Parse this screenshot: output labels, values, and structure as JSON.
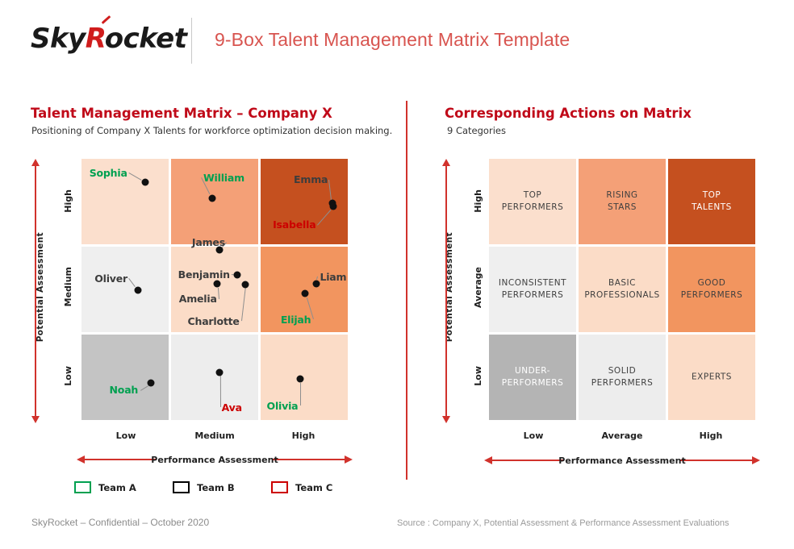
{
  "header": {
    "logo_part1": "Sky",
    "logo_part2": "R",
    "logo_part3": "ocket",
    "title": "9-Box Talent Management Matrix Template"
  },
  "left_panel": {
    "title": "Talent Management Matrix – Company X",
    "subtitle": "Positioning of Company X Talents for workforce optimization decision making.",
    "y_axis_title": "Potential Assessment",
    "y_ticks": [
      "High",
      "Medium",
      "Low"
    ],
    "x_axis_title": "Performance Assessment",
    "x_ticks": [
      "Low",
      "Medium",
      "High"
    ],
    "cell_colors": [
      [
        "#FBDFCD",
        "#F4A077",
        "#C5501F"
      ],
      [
        "#EFEFEF",
        "#FBDCC7",
        "#F2955F"
      ],
      [
        "#C4C4C4",
        "#EDEDED",
        "#FBDCC7"
      ]
    ],
    "people": [
      {
        "name": "Sophia",
        "team": "team-a",
        "cell": 0,
        "dot_x": 0.73,
        "dot_y": 0.27,
        "label_x": 0.09,
        "label_y": 0.09,
        "label_anchor": "left"
      },
      {
        "name": "William",
        "team": "team-a",
        "cell": 1,
        "dot_x": 0.47,
        "dot_y": 0.46,
        "label_x": 0.37,
        "label_y": 0.15,
        "label_anchor": "left"
      },
      {
        "name": "Emma",
        "team": "team-b",
        "cell": 2,
        "dot_x": 0.82,
        "dot_y": 0.52,
        "label_x": 0.38,
        "label_y": 0.17,
        "label_anchor": "left"
      },
      {
        "name": "Isabella",
        "team": "team-c",
        "cell": 2,
        "dot_x": 0.83,
        "dot_y": 0.56,
        "label_x": 0.14,
        "label_y": 0.7,
        "label_anchor": "left"
      },
      {
        "name": "Oliver",
        "team": "team-b",
        "cell": 3,
        "dot_x": 0.65,
        "dot_y": 0.51,
        "label_x": 0.15,
        "label_y": 0.3,
        "label_anchor": "left"
      },
      {
        "name": "James",
        "team": "team-b",
        "cell": 4,
        "dot_x": 0.56,
        "dot_y": 0.04,
        "label_x": 0.24,
        "label_y": -0.12,
        "label_anchor": "left"
      },
      {
        "name": "Benjamin",
        "team": "team-b",
        "cell": 4,
        "dot_x": 0.76,
        "dot_y": 0.33,
        "label_x": 0.08,
        "label_y": 0.25,
        "label_anchor": "left"
      },
      {
        "name": "Amelia",
        "team": "team-b",
        "cell": 4,
        "dot_x": 0.53,
        "dot_y": 0.43,
        "label_x": 0.09,
        "label_y": 0.54,
        "label_anchor": "left"
      },
      {
        "name": "Charlotte",
        "team": "team-b",
        "cell": 4,
        "dot_x": 0.85,
        "dot_y": 0.44,
        "label_x": 0.19,
        "label_y": 0.8,
        "label_anchor": "left"
      },
      {
        "name": "Liam",
        "team": "team-b",
        "cell": 5,
        "dot_x": 0.64,
        "dot_y": 0.43,
        "label_x": 0.68,
        "label_y": 0.28,
        "label_anchor": "left"
      },
      {
        "name": "Elijah",
        "team": "team-a",
        "cell": 5,
        "dot_x": 0.51,
        "dot_y": 0.55,
        "label_x": 0.23,
        "label_y": 0.78,
        "label_anchor": "left"
      },
      {
        "name": "Noah",
        "team": "team-a",
        "cell": 6,
        "dot_x": 0.8,
        "dot_y": 0.57,
        "label_x": 0.32,
        "label_y": 0.58,
        "label_anchor": "left"
      },
      {
        "name": "Ava",
        "team": "team-c",
        "cell": 7,
        "dot_x": 0.56,
        "dot_y": 0.44,
        "label_x": 0.58,
        "label_y": 0.78,
        "label_anchor": "left"
      },
      {
        "name": "Olivia",
        "team": "team-a",
        "cell": 8,
        "dot_x": 0.45,
        "dot_y": 0.52,
        "label_x": 0.07,
        "label_y": 0.76,
        "label_anchor": "left"
      }
    ],
    "legend": [
      {
        "label": "Team A",
        "color": "#00a050"
      },
      {
        "label": "Team B",
        "color": "#000000"
      },
      {
        "label": "Team C",
        "color": "#cc0000"
      }
    ]
  },
  "right_panel": {
    "title": "Corresponding Actions on Matrix",
    "subtitle": "9 Categories",
    "y_axis_title": "Potential Assessment",
    "y_ticks": [
      "High",
      "Average",
      "Low"
    ],
    "x_axis_title": "Performance Assessment",
    "x_ticks": [
      "Low",
      "Average",
      "High"
    ],
    "categories": [
      {
        "line1": "TOP",
        "line2": "PERFORMERS",
        "bg": "#FBDFCD",
        "dark_bg": false
      },
      {
        "line1": "RISING",
        "line2": "STARS",
        "bg": "#F4A077",
        "dark_bg": false
      },
      {
        "line1": "TOP",
        "line2": "TALENTS",
        "bg": "#C5501F",
        "dark_bg": true
      },
      {
        "line1": "INCONSISTENT",
        "line2": "PERFORMERS",
        "bg": "#EFEFEF",
        "dark_bg": false
      },
      {
        "line1": "BASIC",
        "line2": "PROFESSIONALS",
        "bg": "#FBDCC7",
        "dark_bg": false
      },
      {
        "line1": "GOOD",
        "line2": "PERFORMERS",
        "bg": "#F2955F",
        "dark_bg": false
      },
      {
        "line1": "UNDER-",
        "line2": "PERFORMERS",
        "bg": "#B4B4B4",
        "dark_bg": true
      },
      {
        "line1": "SOLID",
        "line2": "PERFORMERS",
        "bg": "#EDEDED",
        "dark_bg": false
      },
      {
        "line1": "EXPERTS",
        "line2": "",
        "bg": "#FBDCC7",
        "dark_bg": false
      }
    ]
  },
  "footer": {
    "left": "SkyRocket – Confidential – October 2020",
    "right": "Source : Company X, Potential Assessment & Performance Assessment Evaluations"
  }
}
